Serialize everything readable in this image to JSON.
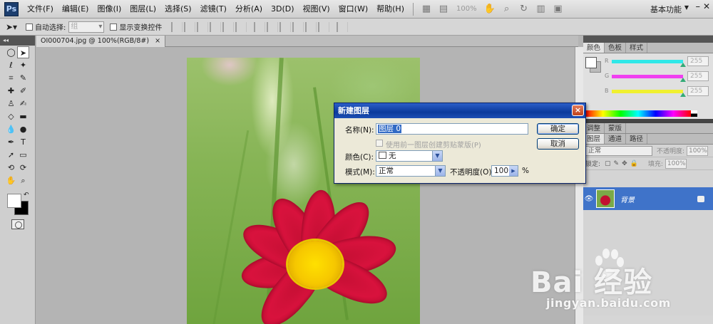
{
  "menubar": {
    "logo": "Ps",
    "items": [
      "文件(F)",
      "编辑(E)",
      "图像(I)",
      "图层(L)",
      "选择(S)",
      "滤镜(T)",
      "分析(A)",
      "3D(D)",
      "视图(V)",
      "窗口(W)",
      "帮助(H)"
    ],
    "zoom": "100%",
    "workspace": "基本功能"
  },
  "options": {
    "auto_select_label": "自动选择:",
    "auto_select_value": "组",
    "show_transform_label": "显示变换控件"
  },
  "document": {
    "tab_title": "OI000704.jpg @ 100%(RGB/8#)",
    "tab_close": "×"
  },
  "panels": {
    "top_tabs": [
      "颜色",
      "色板",
      "样式"
    ],
    "color": {
      "sliders": [
        {
          "letter": "R",
          "value": "255",
          "gradient": "#30e8e8"
        },
        {
          "letter": "G",
          "value": "255",
          "gradient": "#f040f0"
        },
        {
          "letter": "B",
          "value": "255",
          "gradient": "#f0f030"
        }
      ]
    },
    "mid_tabs": [
      "调整",
      "蒙版"
    ],
    "layer_tabs": [
      "图层",
      "通道",
      "路径"
    ],
    "blend_mode": "正常",
    "opacity_label": "不透明度:",
    "opacity_value": "100%",
    "lock_label": "锁定:",
    "fill_label": "填充:",
    "fill_value": "100%",
    "layer_name": "背景"
  },
  "dialog": {
    "title": "新建图层",
    "close": "×",
    "name_label": "名称(N):",
    "name_value": "图层 0",
    "clip_label": "使用前一图层创建剪贴蒙版(P)",
    "color_label": "颜色(C):",
    "color_value": "无",
    "mode_label": "模式(M):",
    "mode_value": "正常",
    "opacity_label": "不透明度(O):",
    "opacity_value": "100",
    "percent": "%",
    "ok": "确定",
    "cancel": "取消"
  },
  "watermark": {
    "brand": "Bai 经验",
    "url": "jingyan.baidu.com"
  }
}
